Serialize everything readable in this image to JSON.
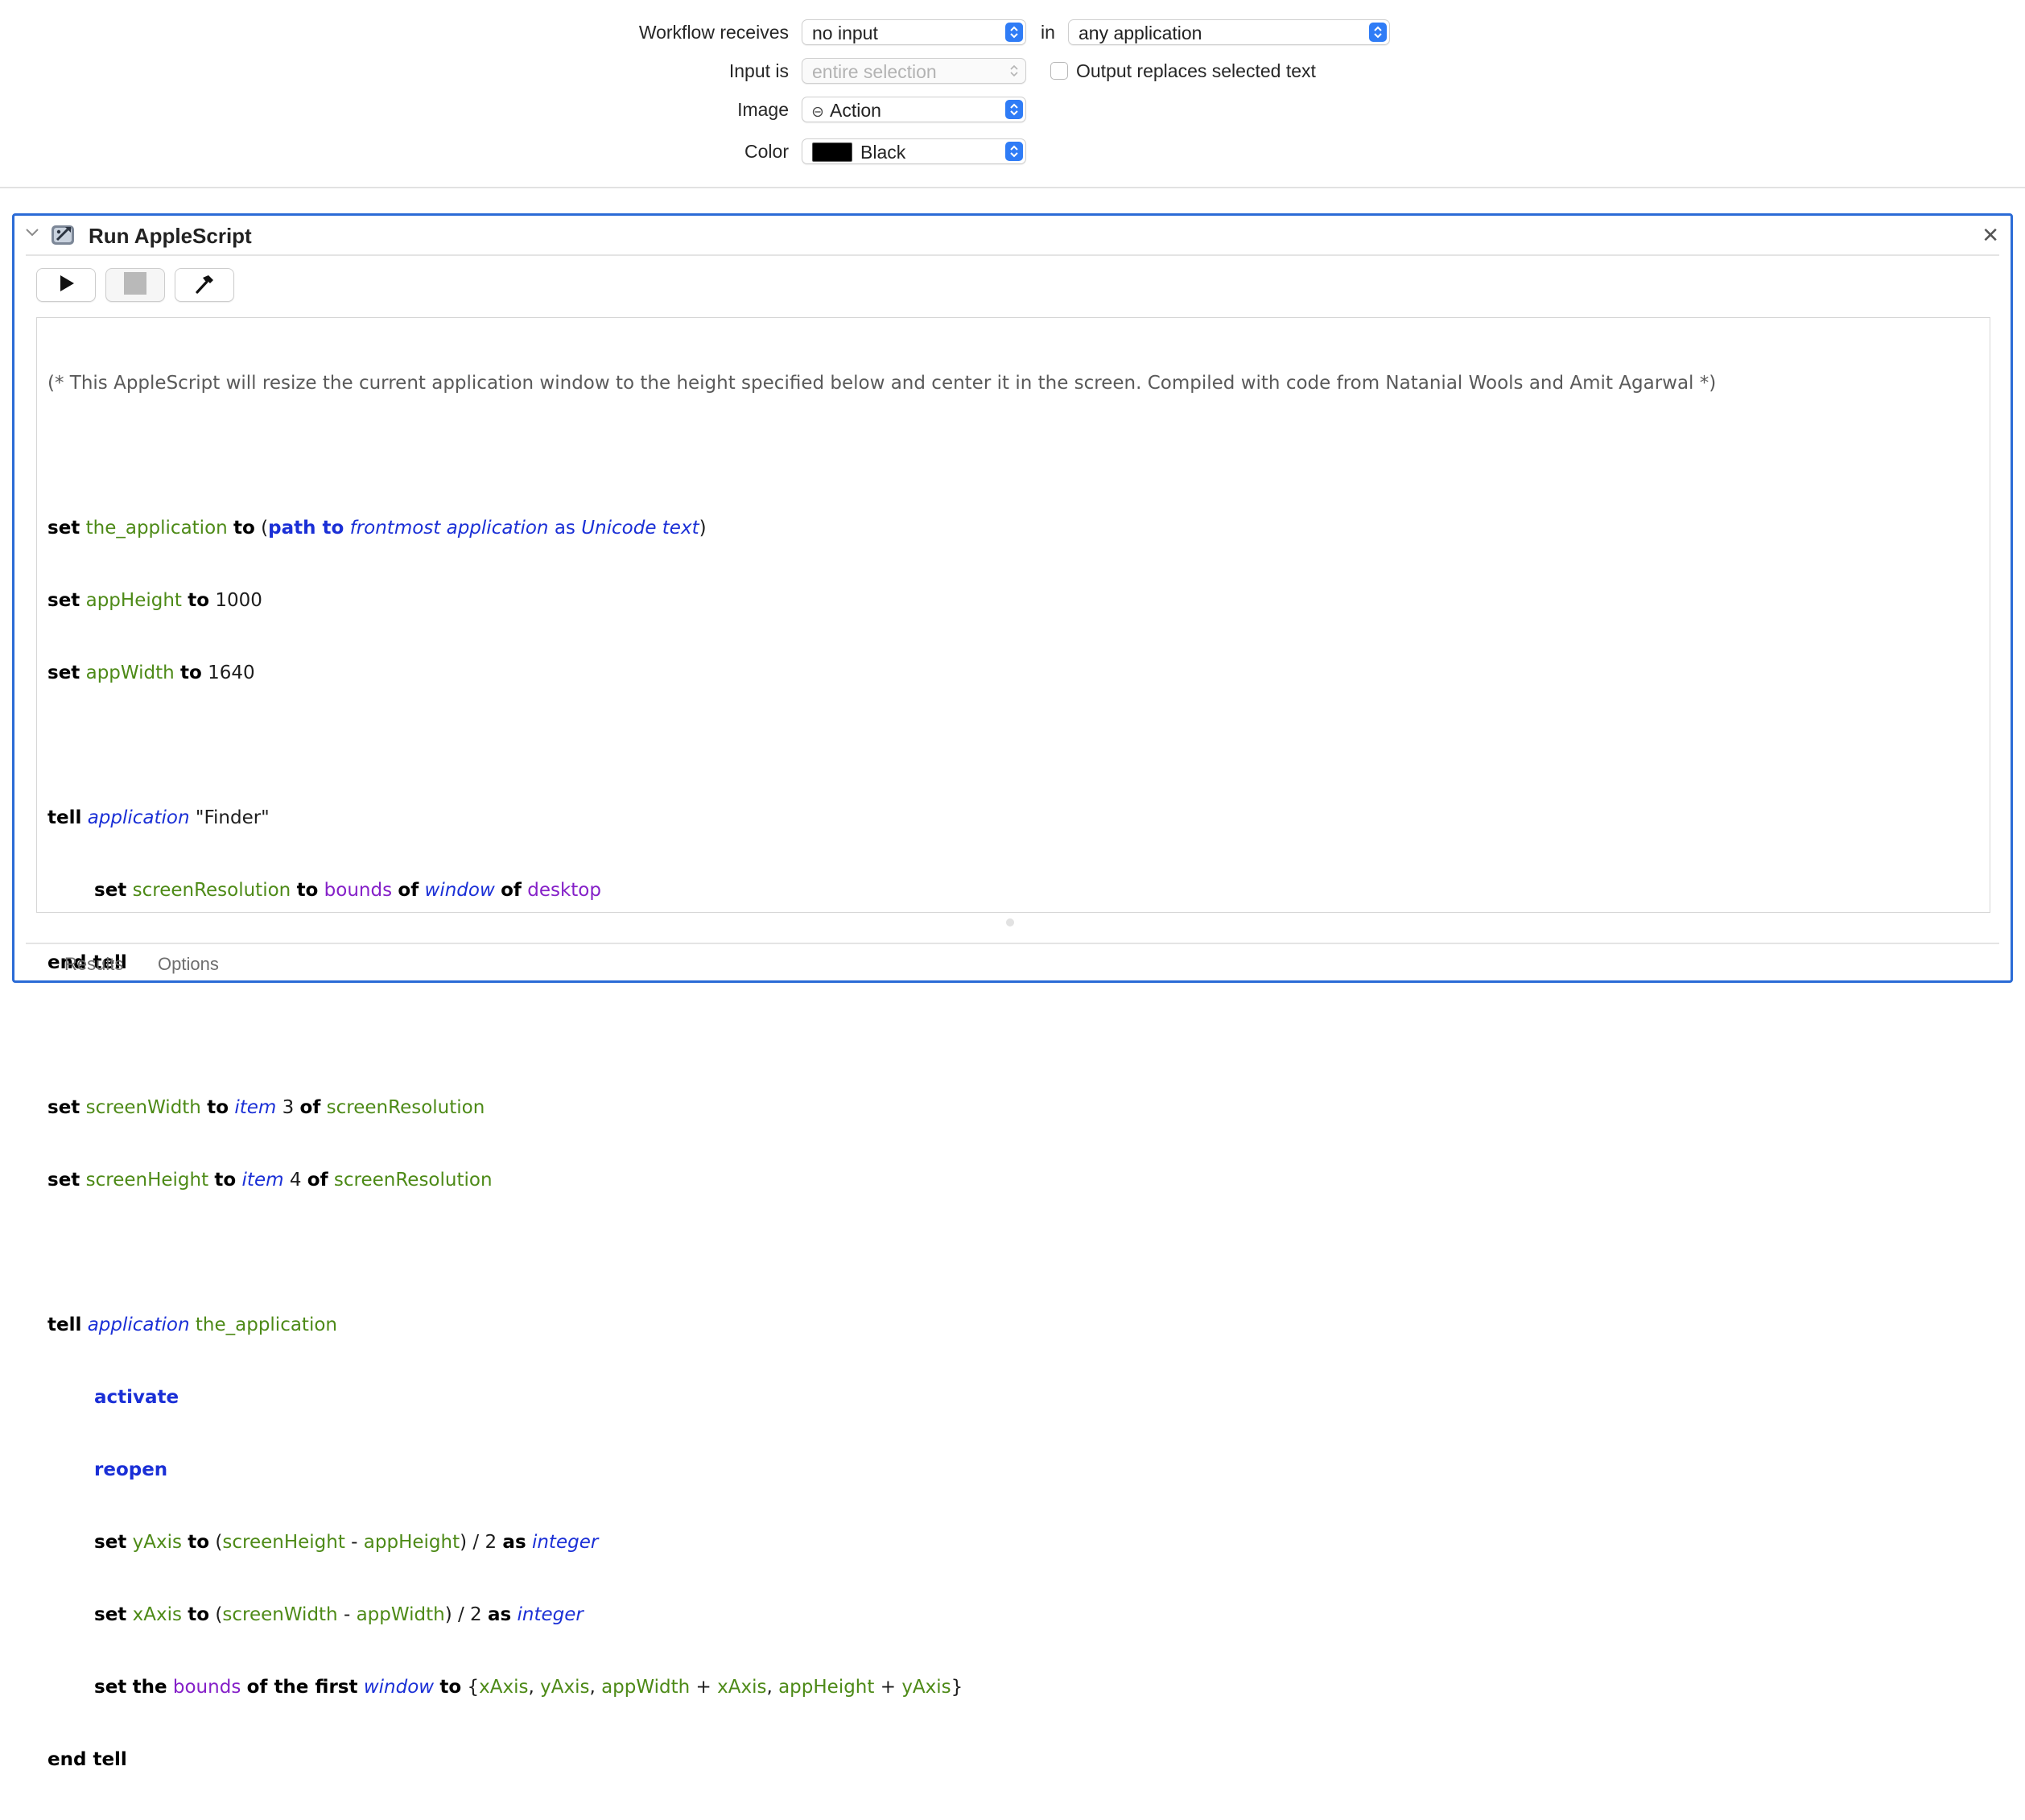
{
  "workflow": {
    "receives_label": "Workflow receives",
    "receives_value": "no input",
    "in_label": "in",
    "app_value": "any application",
    "input_is_label": "Input is",
    "input_is_value": "entire selection",
    "output_replaces_label": "Output replaces selected text",
    "image_label": "Image",
    "image_value": "Action",
    "color_label": "Color",
    "color_value": "Black",
    "color_swatch": "#000000",
    "accent_color": "#2f7cf6"
  },
  "action": {
    "title": "Run AppleScript",
    "icon": "applescript-icon",
    "tabs": [
      "Results",
      "Options"
    ],
    "border_color": "#2b6bd6"
  },
  "script": {
    "comment": "(* This AppleScript will resize the current application window to the height specified below and center it in the screen. Compiled with code from Natanial Wools and Amit Agarwal *)",
    "kw_set": "set",
    "kw_to": "to",
    "kw_tell": "tell",
    "kw_end_tell": "end tell",
    "kw_of": "of",
    "kw_as": "as",
    "kw_the": "the",
    "kw_of_the_first": "of the first",
    "cmd_path_to": "path to",
    "cmd_activate": "activate",
    "cmd_reopen": "reopen",
    "cls_frontmost": "frontmost application",
    "cls_unicode": "Unicode text",
    "cls_application": "application",
    "cls_window": "window",
    "cls_item": "item",
    "cls_integer": "integer",
    "prop_bounds": "bounds",
    "prop_desktop": "desktop",
    "v_the_application": "the_application",
    "v_appHeight": "appHeight",
    "v_appWidth": "appWidth",
    "v_screenResolution": "screenResolution",
    "v_screenWidth": "screenWidth",
    "v_screenHeight": "screenHeight",
    "v_yAxis": "yAxis",
    "v_xAxis": "xAxis",
    "n_1000": "1000",
    "n_1640": "1640",
    "n_3": "3",
    "n_4": "4",
    "n_2": "2",
    "str_finder": "\"Finder\"",
    "p_open": "(",
    "p_close": ")",
    "op_minus": " - ",
    "op_div": ") / ",
    "op_plus": " + ",
    "br_open": "{",
    "br_close": "}",
    "comma": ", "
  },
  "icons": {
    "disclosure": "chevron-down-icon",
    "close": "close-icon",
    "run": "play-icon",
    "stop": "stop-icon",
    "compile": "hammer-icon"
  }
}
